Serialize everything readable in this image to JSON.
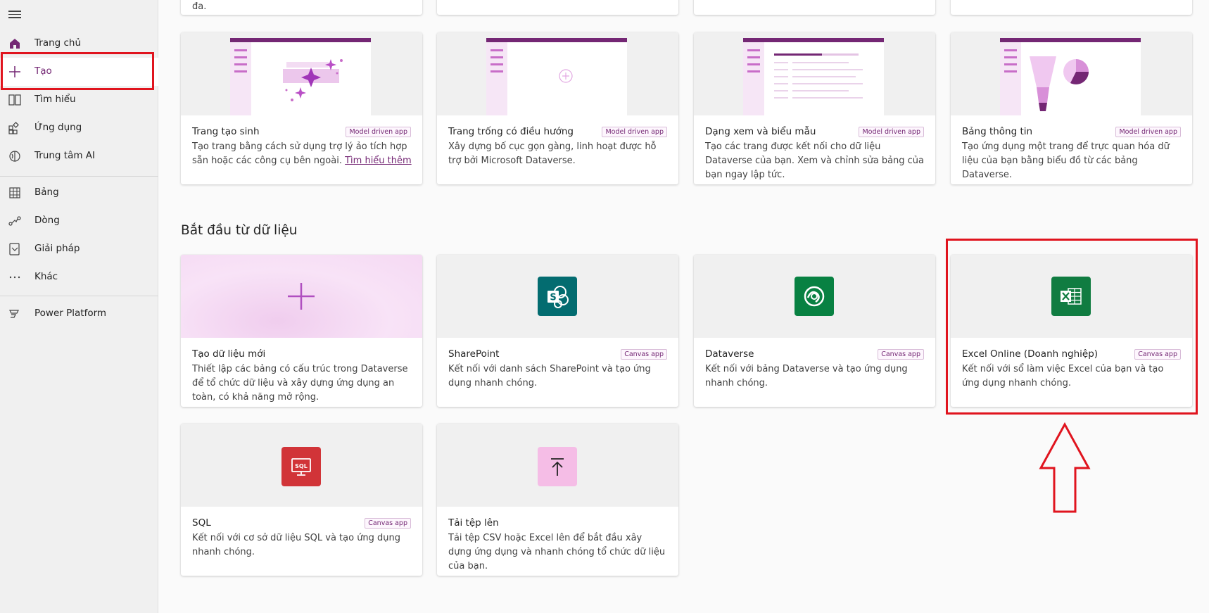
{
  "sidebar": {
    "items": [
      {
        "label": "Trang chủ",
        "icon": "home-icon"
      },
      {
        "label": "Tạo",
        "icon": "plus-icon"
      },
      {
        "label": "Tìm hiểu",
        "icon": "book-icon"
      },
      {
        "label": "Ứng dụng",
        "icon": "apps-icon"
      },
      {
        "label": "Trung tâm AI",
        "icon": "brain-icon"
      },
      {
        "label": "Bảng",
        "icon": "table-icon"
      },
      {
        "label": "Dòng",
        "icon": "flow-icon"
      },
      {
        "label": "Giải pháp",
        "icon": "solution-icon"
      },
      {
        "label": "Khác",
        "icon": "more-icon"
      },
      {
        "label": "Power Platform",
        "icon": "power-platform-icon"
      }
    ]
  },
  "top_partial": {
    "text": "đa."
  },
  "page_cards": [
    {
      "title": "Trang tạo sinh",
      "badge": "Model driven app",
      "desc": "Tạo trang bằng cách sử dụng trợ lý ảo tích hợp sẵn hoặc các công cụ bên ngoài.",
      "link": "Tìm hiểu thêm"
    },
    {
      "title": "Trang trống có điều hướng",
      "badge": "Model driven app",
      "desc": "Xây dựng bố cục gọn gàng, linh hoạt được hỗ trợ bởi Microsoft Dataverse."
    },
    {
      "title": "Dạng xem và biểu mẫu",
      "badge": "Model driven app",
      "desc": "Tạo các trang được kết nối cho dữ liệu Dataverse của bạn. Xem và chỉnh sửa bảng của bạn ngay lập tức."
    },
    {
      "title": "Bảng thông tin",
      "badge": "Model driven app",
      "desc": "Tạo ứng dụng một trang để trực quan hóa dữ liệu của bạn bằng biểu đồ từ các bảng Dataverse."
    }
  ],
  "section": {
    "title": "Bắt đầu từ dữ liệu"
  },
  "data_cards": [
    {
      "title": "Tạo dữ liệu mới",
      "badge": "",
      "desc": "Thiết lập các bảng có cấu trúc trong Dataverse để tổ chức dữ liệu và xây dựng ứng dụng an toàn, có khả năng mở rộng."
    },
    {
      "title": "SharePoint",
      "badge": "Canvas app",
      "desc": "Kết nối với danh sách SharePoint và tạo ứng dụng nhanh chóng."
    },
    {
      "title": "Dataverse",
      "badge": "Canvas app",
      "desc": "Kết nối với bảng Dataverse và tạo ứng dụng nhanh chóng."
    },
    {
      "title": "Excel Online (Doanh nghiệp)",
      "badge": "Canvas app",
      "desc": "Kết nối với sổ làm việc Excel của bạn và tạo ứng dụng nhanh chóng."
    },
    {
      "title": "SQL",
      "badge": "Canvas app",
      "desc": "Kết nối với cơ sở dữ liệu SQL và tạo ứng dụng nhanh chóng."
    },
    {
      "title": "Tải tệp lên",
      "badge": "",
      "desc": "Tải tệp CSV hoặc Excel lên để bắt đầu xây dựng ứng dụng và nhanh chóng tổ chức dữ liệu của bạn."
    }
  ],
  "colors": {
    "accent": "#742774",
    "highlight": "#e0141e",
    "sharepoint": "#036c70",
    "dataverse": "#088142",
    "excel": "#107c41",
    "sql": "#d13438",
    "upload": "#f5bde6"
  }
}
